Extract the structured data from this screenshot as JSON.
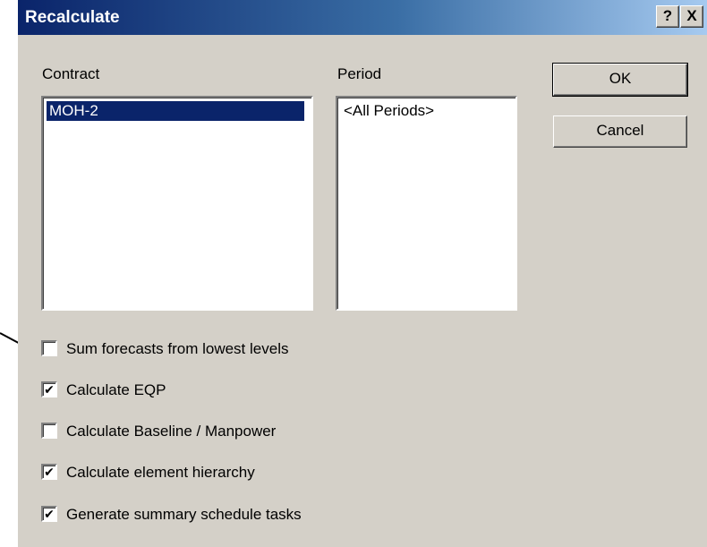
{
  "window": {
    "title": "Recalculate",
    "help_glyph": "?",
    "close_glyph": "X"
  },
  "contract": {
    "label": "Contract",
    "items": [
      {
        "text": "MOH-2",
        "selected": true
      }
    ]
  },
  "period": {
    "label": "Period",
    "items": [
      {
        "text": "<All Periods>",
        "selected": false
      }
    ]
  },
  "buttons": {
    "ok": "OK",
    "cancel": "Cancel"
  },
  "options": [
    {
      "label": "Sum forecasts from lowest levels",
      "checked": false,
      "mark": ""
    },
    {
      "label": "Calculate EQP",
      "checked": true,
      "mark": "✔"
    },
    {
      "label": "Calculate Baseline / Manpower",
      "checked": false,
      "mark": ""
    },
    {
      "label": "Calculate element hierarchy",
      "checked": true,
      "mark": "✔"
    },
    {
      "label": "Generate summary schedule tasks",
      "checked": true,
      "mark": "✔"
    }
  ],
  "colors": {
    "titlebar_start": "#0a246a",
    "titlebar_end": "#a6caf0",
    "face": "#d4d0c8",
    "selection": "#0a246a"
  }
}
